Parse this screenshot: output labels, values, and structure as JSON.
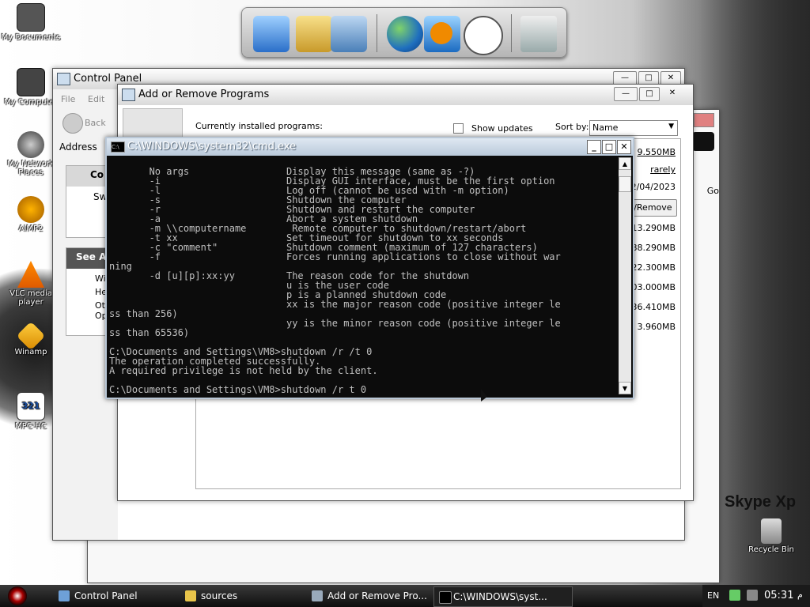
{
  "desktop": {
    "icons": [
      {
        "label": "My Documents"
      },
      {
        "label": "My Computer"
      },
      {
        "label": "My Network Places"
      },
      {
        "label": "AIMP2"
      },
      {
        "label": "VLC media player"
      },
      {
        "label": "Winamp"
      },
      {
        "label": "MPC-HC"
      }
    ],
    "recycle_label": "Recycle Bin",
    "skype_text": "Skype Xp"
  },
  "control_panel": {
    "title": "Control Panel",
    "menu": [
      "File",
      "Edit"
    ],
    "back_label": "Back",
    "address_label": "Address",
    "see_also": "See Also",
    "task_items": [
      "Co",
      "Sw"
    ],
    "side_items": [
      "Wi",
      "He",
      "Otl Op"
    ],
    "go_label": "Go"
  },
  "arp": {
    "title": "Add or Remove Programs",
    "currently_installed": "Currently installed programs:",
    "show_updates": "Show updates",
    "sort_by_label": "Sort by:",
    "sort_value": "Name",
    "size_first": "9.550MB",
    "used": "rarely",
    "last_used": "2/04/2023",
    "remove_button": "e/Remove",
    "sizes": [
      "13.290MB",
      "88.290MB",
      "22.300MB",
      "103.000MB",
      "36.410MB",
      "3.960MB"
    ]
  },
  "cmd": {
    "title": "C:\\WINDOWS\\system32\\cmd.exe",
    "icon_text": "C:\\",
    "lines": [
      "       No args                 Display this message (same as -?)",
      "       -i                      Display GUI interface, must be the first option",
      "       -l                      Log off (cannot be used with -m option)",
      "       -s                      Shutdown the computer",
      "       -r                      Shutdown and restart the computer",
      "       -a                      Abort a system shutdown",
      "       -m \\\\computername        Remote computer to shutdown/restart/abort",
      "       -t xx                   Set timeout for shutdown to xx seconds",
      "       -c \"comment\"            Shutdown comment (maximum of 127 characters)",
      "       -f                      Forces running applications to close without war",
      "ning",
      "       -d [u][p]:xx:yy         The reason code for the shutdown",
      "                               u is the user code",
      "                               p is a planned shutdown code",
      "                               xx is the major reason code (positive integer le",
      "ss than 256)",
      "                               yy is the minor reason code (positive integer le",
      "ss than 65536)",
      "",
      "C:\\Documents and Settings\\VM8>shutdown /r /t 0",
      "The operation completed successfully.",
      "A required privilege is not held by the client.",
      "",
      "C:\\Documents and Settings\\VM8>shutdown /r t 0"
    ]
  },
  "taskbar": {
    "items": [
      {
        "label": "Control Panel"
      },
      {
        "label": "sources"
      },
      {
        "label": "Add or Remove Pro..."
      },
      {
        "label": "C:\\WINDOWS\\syst..."
      }
    ],
    "lang": "EN",
    "time": "05:31",
    "ampm": "م"
  }
}
